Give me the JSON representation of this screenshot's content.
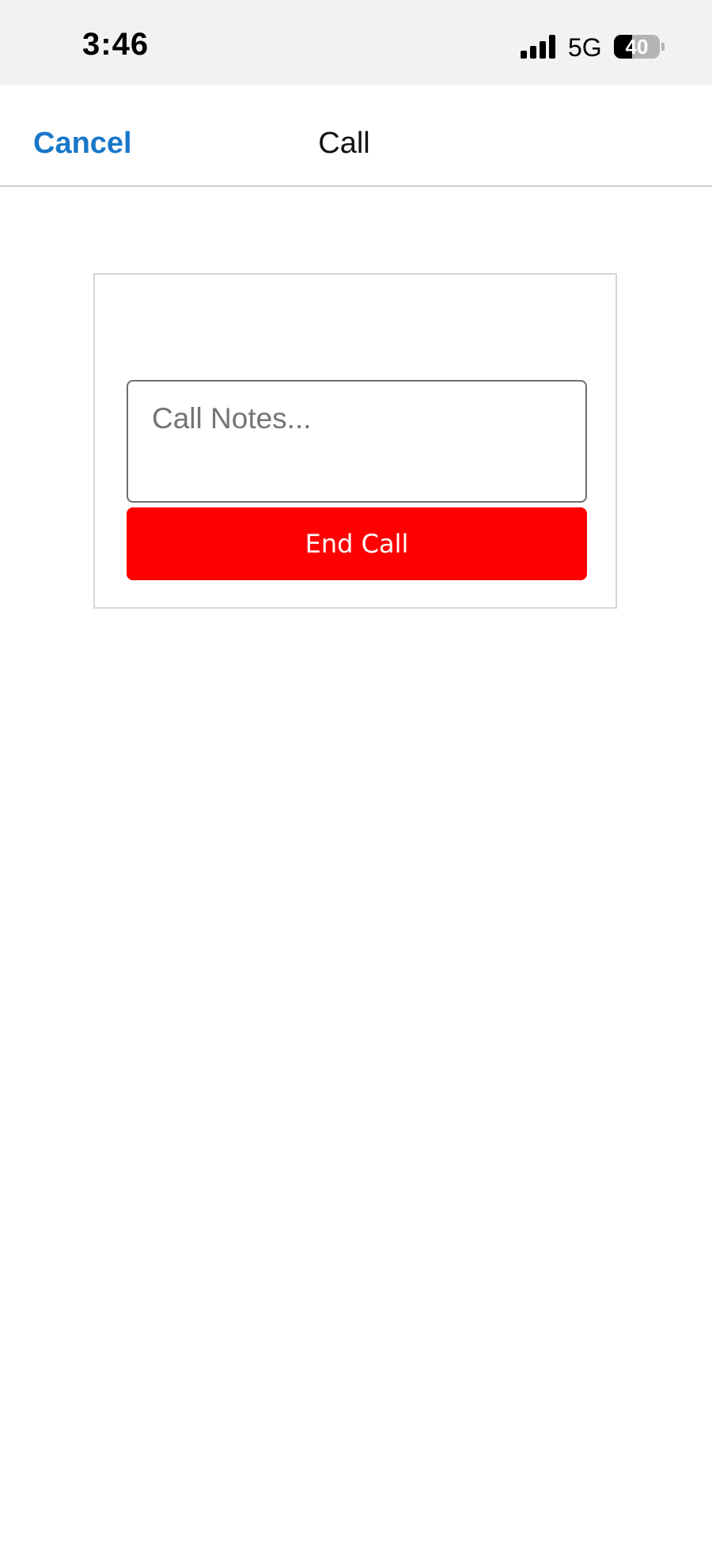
{
  "status_bar": {
    "time": "3:46",
    "network": "5G",
    "battery_level": "40",
    "battery_fraction": 0.4
  },
  "nav": {
    "cancel_label": "Cancel",
    "title": "Call"
  },
  "form": {
    "notes_placeholder": "Call Notes...",
    "notes_value": "",
    "end_call_label": "End Call"
  },
  "colors": {
    "accent": "#1877c9",
    "end_call": "#ff0000",
    "status_bar_bg": "#f2f2f2"
  },
  "icons": {
    "signal": "signal-bars-icon",
    "battery": "battery-icon"
  }
}
